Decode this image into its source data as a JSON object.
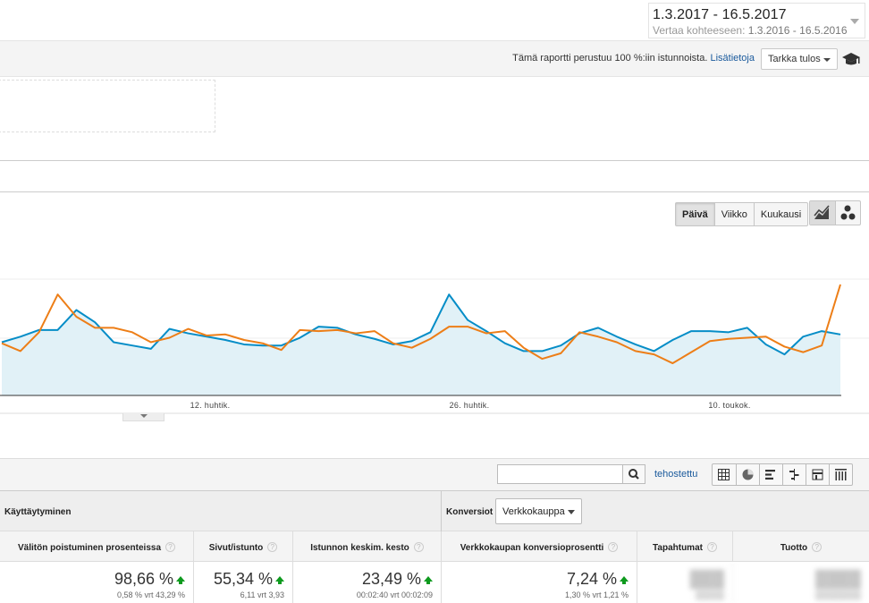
{
  "date_range": {
    "main": "1.3.2017 - 16.5.2017",
    "compare_label": "Vertaa kohteeseen:",
    "compare_value": "1.3.2016 - 16.5.2016"
  },
  "sampling": {
    "text": "Tämä raportti perustuu 100 %:iin istunnoista.",
    "link": "Lisätietoja",
    "accuracy_label": "Tarkka tulos"
  },
  "chart_controls": {
    "buttons": [
      "Päivä",
      "Viikko",
      "Kuukausi"
    ],
    "active": "Päivä"
  },
  "chart_data": {
    "type": "line",
    "x_tick_labels": [
      "12. huhtik.",
      "26. huhtik.",
      "10. toukok."
    ],
    "series": [
      {
        "color": "#058dc7",
        "values": [
          48,
          53,
          59,
          59,
          77,
          66,
          48,
          45,
          42,
          60,
          56,
          53,
          50,
          46,
          45,
          45,
          52,
          62,
          61,
          55,
          51,
          46,
          49,
          57,
          91,
          68,
          58,
          47,
          40,
          40,
          45,
          56,
          61,
          53,
          46,
          40,
          50,
          58,
          58,
          57,
          61,
          46,
          37,
          53,
          58,
          55
        ]
      },
      {
        "color": "#ed7e17",
        "values": [
          47,
          40,
          57,
          91,
          71,
          61,
          61,
          57,
          48,
          52,
          60,
          54,
          55,
          50,
          47,
          41,
          59,
          58,
          59,
          56,
          58,
          47,
          43,
          51,
          62,
          62,
          56,
          58,
          43,
          33,
          38,
          57,
          53,
          48,
          40,
          37,
          29,
          39,
          49,
          51,
          52,
          53,
          44,
          39,
          45,
          100
        ]
      }
    ]
  },
  "table": {
    "advanced_link": "tehostettu",
    "group_behavior": "Käyttäytyminen",
    "group_conversions": "Konversiot",
    "conversion_select": "Verkkokauppa",
    "help_glyph": "?",
    "columns": [
      {
        "header": "Välitön poistuminen prosenteissa",
        "value": "98,66 %",
        "compare": "0,58 % vrt 43,29 %"
      },
      {
        "header": "Sivut/istunto",
        "value": "55,34 %",
        "compare": "6,11 vrt 3,93"
      },
      {
        "header": "Istunnon keskim. kesto",
        "value": "23,49 %",
        "compare": "00:02:40 vrt 00:02:09"
      },
      {
        "header": "Verkkokaupan konversioprosentti",
        "value": "7,24 %",
        "compare": "1,30 % vrt 1,21 %"
      },
      {
        "header": "Tapahtumat",
        "value": "",
        "compare": ""
      },
      {
        "header": "Tuotto",
        "value": "",
        "compare": ""
      }
    ]
  }
}
